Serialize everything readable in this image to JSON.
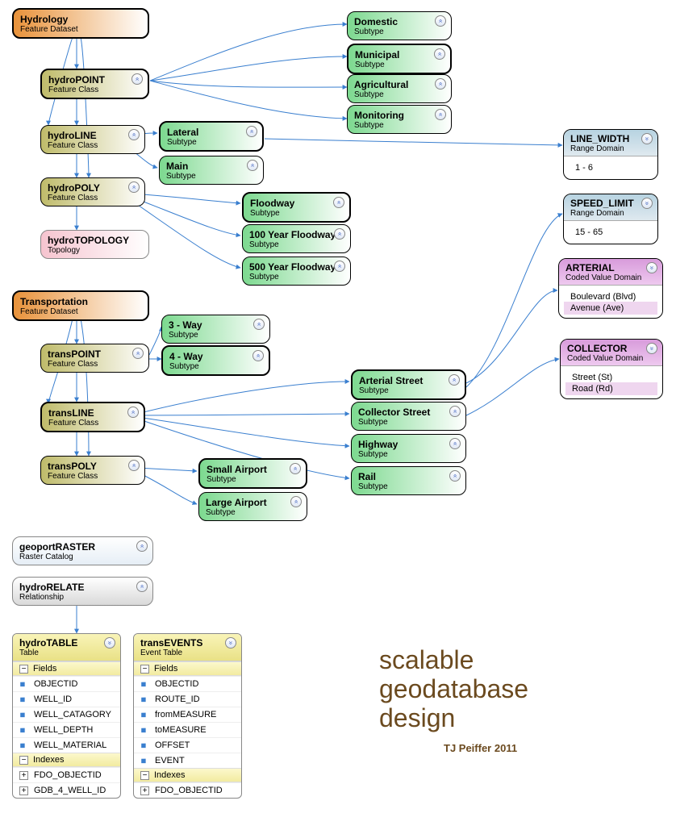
{
  "fd": {
    "label": "Feature Dataset"
  },
  "fc": {
    "label": "Feature Class"
  },
  "st": {
    "label": "Subtype"
  },
  "tp": {
    "label": "Topology"
  },
  "rd": {
    "label": "Range Domain"
  },
  "cvd": {
    "label": "Coded Value Domain"
  },
  "rc": {
    "label": "Raster Catalog"
  },
  "rel": {
    "label": "Relationship"
  },
  "tbl": {
    "label": "Table"
  },
  "et": {
    "label": "Event Table"
  },
  "fields": {
    "label": "Fields"
  },
  "indexes": {
    "label": "Indexes"
  },
  "hydrology": {
    "t": "Hydrology"
  },
  "hydroPoint": {
    "t": "hydroPOINT"
  },
  "hydroLine": {
    "t": "hydroLINE"
  },
  "hydroPoly": {
    "t": "hydroPOLY"
  },
  "hydroTopo": {
    "t": "hydroTOPOLOGY"
  },
  "domestic": {
    "t": "Domestic"
  },
  "municipal": {
    "t": "Municipal"
  },
  "agricultural": {
    "t": "Agricultural"
  },
  "monitoring": {
    "t": "Monitoring"
  },
  "lateral": {
    "t": "Lateral"
  },
  "main": {
    "t": "Main"
  },
  "floodway": {
    "t": "Floodway"
  },
  "fw100": {
    "t": "100 Year Floodway"
  },
  "fw500": {
    "t": "500 Year Floodway"
  },
  "transportation": {
    "t": "Transportation"
  },
  "transPoint": {
    "t": "transPOINT"
  },
  "transLine": {
    "t": "transLINE"
  },
  "transPoly": {
    "t": "transPOLY"
  },
  "w3": {
    "t": "3 - Way"
  },
  "w4": {
    "t": "4 - Way"
  },
  "artS": {
    "t": "Arterial Street"
  },
  "colS": {
    "t": "Collector Street"
  },
  "highway": {
    "t": "Highway"
  },
  "rail": {
    "t": "Rail"
  },
  "smAir": {
    "t": "Small Airport"
  },
  "lgAir": {
    "t": "Large Airport"
  },
  "lineWidth": {
    "t": "LINE_WIDTH",
    "v": "1 - 6"
  },
  "speedLimit": {
    "t": "SPEED_LIMIT",
    "v": "15 - 65"
  },
  "arterial": {
    "t": "ARTERIAL",
    "v": [
      "Boulevard (Blvd)",
      "Avenue (Ave)"
    ]
  },
  "collector": {
    "t": "COLLECTOR",
    "v": [
      "Street (St)",
      "Road (Rd)"
    ]
  },
  "geoRaster": {
    "t": "geoportRASTER"
  },
  "hydroRel": {
    "t": "hydroRELATE"
  },
  "hydroTable": {
    "t": "hydroTABLE",
    "fields": [
      "OBJECTID",
      "WELL_ID",
      "WELL_CATAGORY",
      "WELL_DEPTH",
      "WELL_MATERIAL"
    ],
    "idx": [
      "FDO_OBJECTID",
      "GDB_4_WELL_ID"
    ]
  },
  "transEvents": {
    "t": "transEVENTS",
    "fields": [
      "OBJECTID",
      "ROUTE_ID",
      "fromMEASURE",
      "toMEASURE",
      "OFFSET",
      "EVENT"
    ],
    "idx": [
      "FDO_OBJECTID"
    ]
  },
  "title": {
    "l1": "scalable",
    "l2": "geodatabase",
    "l3": "design",
    "by": "TJ Peiffer  2011"
  }
}
